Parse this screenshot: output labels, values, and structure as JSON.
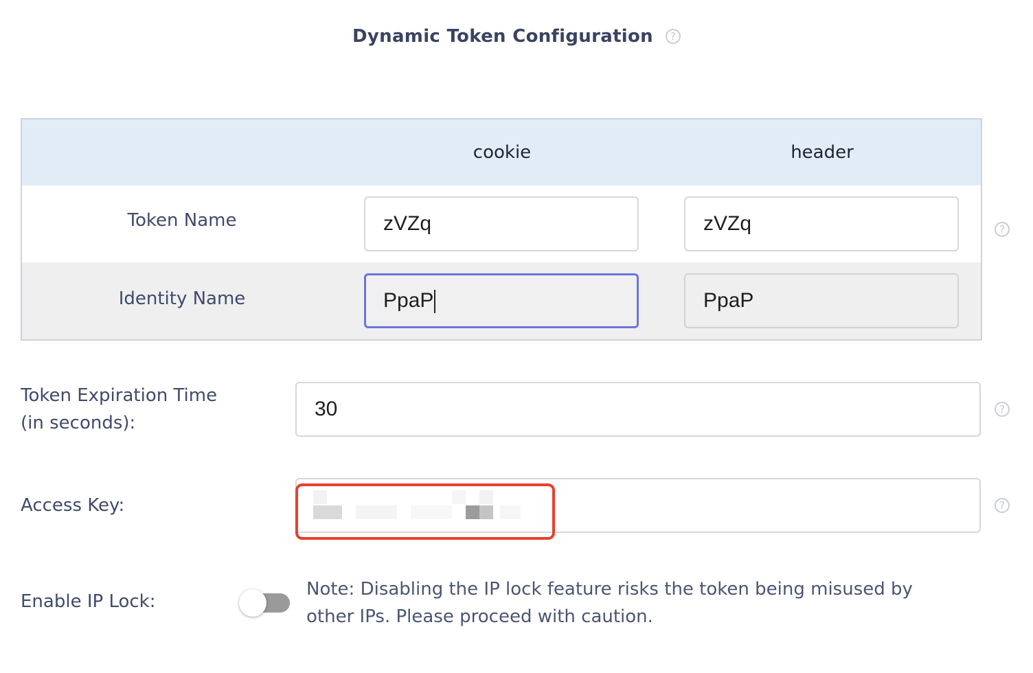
{
  "title": "Dynamic Token Configuration",
  "table": {
    "headers": [
      "",
      "cookie",
      "header"
    ],
    "rows": [
      {
        "label": "Token Name",
        "cookie_value": "zVZq",
        "header_value": "zVZq"
      },
      {
        "label": "Identity Name",
        "cookie_value": "PpaP",
        "header_value": "PpaP"
      }
    ]
  },
  "expiration": {
    "label_line1": "Token Expiration Time",
    "label_line2": "(in seconds):",
    "value": "30"
  },
  "access_key": {
    "label": "Access Key:",
    "value_redacted": true
  },
  "ip_lock": {
    "label": "Enable IP Lock:",
    "enabled": false,
    "note_line1": "Note: Disabling the IP lock feature risks the token being misused by",
    "note_line2": "other IPs. Please proceed with caution."
  },
  "icons": {
    "help": "question-circle-icon",
    "help_glyph": "?"
  },
  "colors": {
    "table_header_bg": "#e2ecf7",
    "focus_border": "#6b74e0",
    "highlight_red": "#e5412d",
    "toggle_off": "#9a9a9a"
  }
}
